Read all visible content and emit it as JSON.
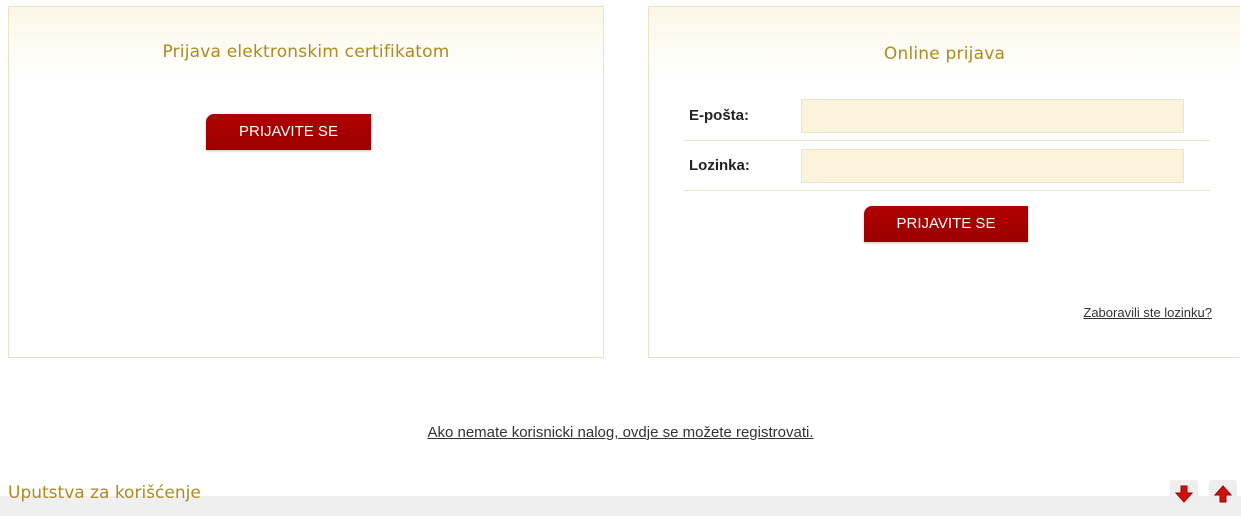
{
  "left_panel": {
    "title": "Prijava elektronskim certifikatom",
    "button_label": "PRIJAVITE SE"
  },
  "right_panel": {
    "title": "Online prijava",
    "email_label": "E-pošta:",
    "email_value": "",
    "password_label": "Lozinka:",
    "password_value": "",
    "button_label": "PRIJAVITE SE",
    "forgot_link": "Zaboravili ste lozinku?"
  },
  "register": {
    "link_text": "Ako nemate korisnicki nalog, ovdje se možete registrovati."
  },
  "instructions": {
    "title": "Uputstva za korišćenje",
    "expand_icon": "arrow-down-icon",
    "collapse_icon": "arrow-up-icon"
  },
  "colors": {
    "accent_gold": "#b08a1e",
    "button_red": "#a00000",
    "input_bg": "#fbf3dc"
  }
}
